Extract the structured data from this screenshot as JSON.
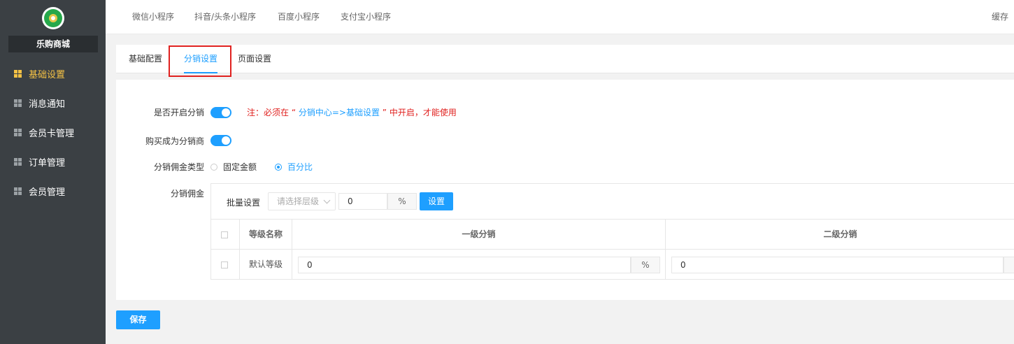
{
  "brand": {
    "name": "乐购商城"
  },
  "sidebar": {
    "items": [
      {
        "label": "基础设置",
        "active": true
      },
      {
        "label": "消息通知",
        "active": false
      },
      {
        "label": "会员卡管理",
        "active": false
      },
      {
        "label": "订单管理",
        "active": false
      },
      {
        "label": "会员管理",
        "active": false
      }
    ]
  },
  "topbar": {
    "tabs": [
      "微信小程序",
      "抖音/头条小程序",
      "百度小程序",
      "支付宝小程序"
    ],
    "right_label": "缓存"
  },
  "subtabs": [
    "基础配置",
    "分销设置",
    "页面设置"
  ],
  "form": {
    "enable_label": "是否开启分销",
    "enable_on": true,
    "note_prefix": "注：必须在 “",
    "note_link": " 分销中心=>基础设置 ",
    "note_suffix": "” 中开启，才能使用",
    "buy_label": "购买成为分销商",
    "buy_on": true,
    "type_label": "分销佣金类型",
    "type_options": [
      "固定金额",
      "百分比"
    ],
    "type_selected": "百分比",
    "commission_label": "分销佣金"
  },
  "batch": {
    "label": "批量设置",
    "select_placeholder": "请选择层级",
    "value": "0",
    "unit": "%",
    "button": "设置"
  },
  "table": {
    "headers": [
      "等级名称",
      "一级分销",
      "二级分销"
    ],
    "rows": [
      {
        "name": "默认等级",
        "level1": "0",
        "level1_unit": "%",
        "level2": "0"
      }
    ]
  },
  "save_label": "保存",
  "colors": {
    "accent": "#1e9fff",
    "sidebar_bg": "#3b4044",
    "active_nav": "#f5c245",
    "note_red": "#e0211f"
  }
}
